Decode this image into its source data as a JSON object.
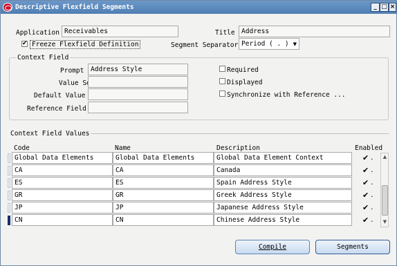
{
  "window": {
    "title": "Descriptive Flexfield Segments",
    "controls": [
      "minimize",
      "maximize",
      "close"
    ]
  },
  "header": {
    "application_label": "Application",
    "application_value": "Receivables",
    "title_label": "Title",
    "title_value": "Address",
    "freeze_label": "Freeze Flexfield Definition",
    "freeze_checked": true,
    "separator_label": "Segment Separator",
    "separator_value": "Period ( . )"
  },
  "context_field": {
    "group_title": "Context Field",
    "prompt_label": "Prompt",
    "prompt_value": "Address Style",
    "value_set_label": "Value Set",
    "value_set_value": "",
    "default_value_label": "Default Value",
    "default_value_value": "",
    "reference_field_label": "Reference Field",
    "reference_field_value": "",
    "required_label": "Required",
    "displayed_label": "Displayed",
    "synchronize_label": "Synchronize with Reference ...",
    "required_checked": false,
    "displayed_checked": false,
    "synchronize_checked": false
  },
  "context_values": {
    "section_title": "Context Field Values",
    "columns": {
      "code": "Code",
      "name": "Name",
      "description": "Description",
      "enabled": "Enabled"
    },
    "rows": [
      {
        "code": "Global Data Elements",
        "name": "Global Data Elements",
        "description": "Global Data Element Context",
        "enabled": true
      },
      {
        "code": "CA",
        "name": "CA",
        "description": "Canada",
        "enabled": true
      },
      {
        "code": "ES",
        "name": "ES",
        "description": "Spain Address Style",
        "enabled": true
      },
      {
        "code": "GR",
        "name": "GR",
        "description": "Greek Address Style",
        "enabled": true
      },
      {
        "code": "JP",
        "name": "JP",
        "description": "Japanese Address Style",
        "enabled": true
      },
      {
        "code": "CN",
        "name": "CN",
        "description": "Chinese Address Style",
        "enabled": true
      }
    ],
    "current_row": 5,
    "enabled_mark": "✔",
    "enabled_dot": "."
  },
  "buttons": {
    "compile": "Compile",
    "segments": "Segments"
  },
  "icons": {
    "minimize": "_",
    "maximize": "□",
    "close": "×",
    "dropdown": "▼",
    "scroll_up": "▲",
    "scroll_down": "▼"
  }
}
